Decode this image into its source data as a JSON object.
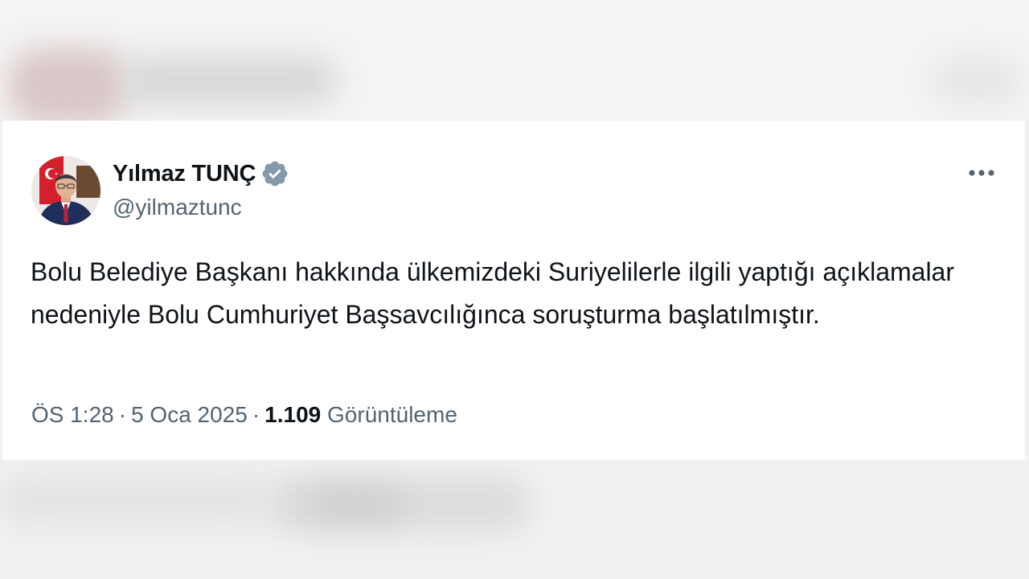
{
  "tweet": {
    "author": {
      "display_name": "Yılmaz TUNÇ",
      "handle": "@yilmaztunc",
      "verified": true,
      "badge_color": "#829aab"
    },
    "text": "Bolu Belediye Başkanı hakkında ülkemizdeki Suriyelilerle ilgili yaptığı açıklamalar nedeniyle Bolu Cumhuriyet Başsavcılığınca soruşturma başlatılmıştır.",
    "time": "ÖS 1:28",
    "separator": "·",
    "date": "5 Oca 2025",
    "views_count": "1.109",
    "views_label": "Görüntüleme",
    "more_icon": "more-horizontal-icon"
  },
  "colors": {
    "text_primary": "#0f1419",
    "text_secondary": "#536471",
    "card_bg": "#ffffff",
    "page_bg": "#f2f2f2"
  }
}
